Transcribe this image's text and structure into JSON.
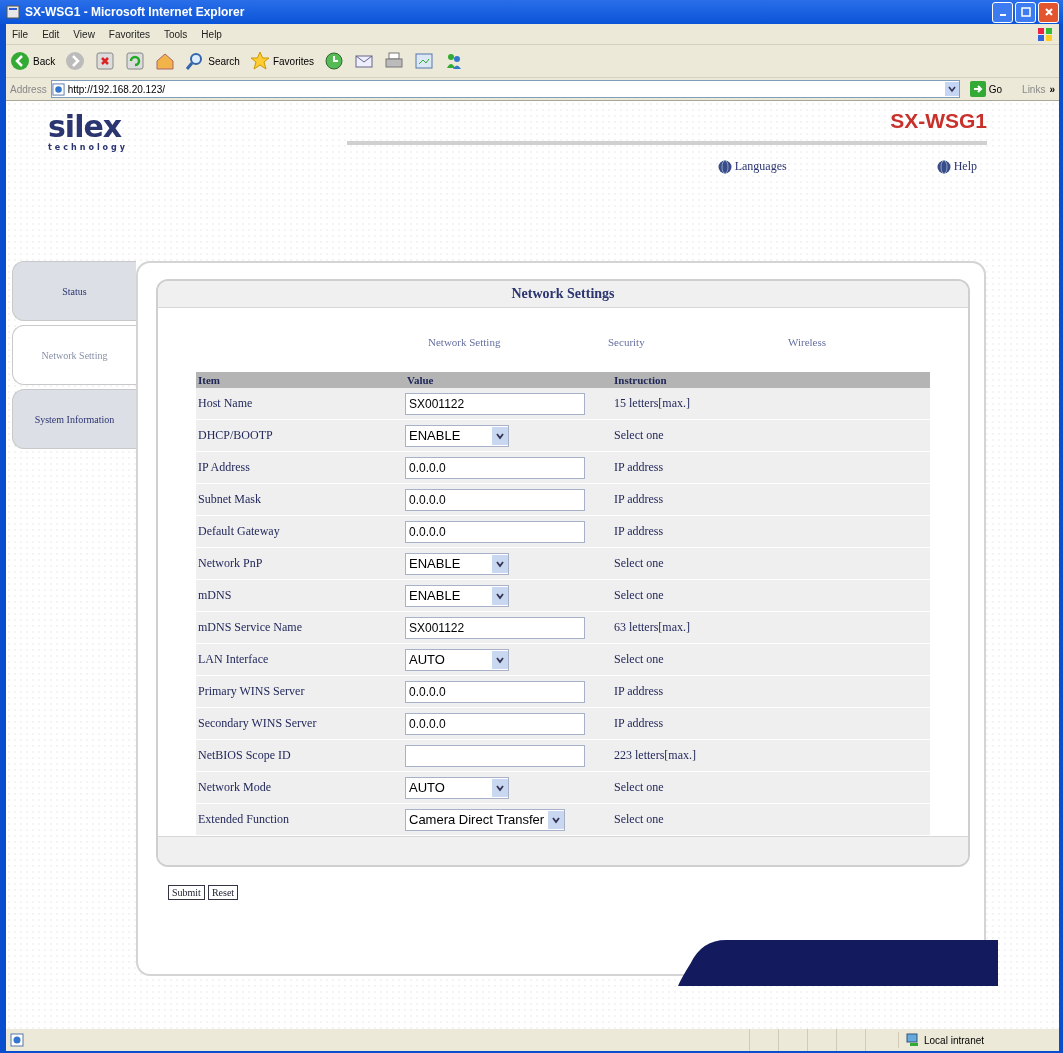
{
  "window": {
    "title": "SX-WSG1 - Microsoft Internet Explorer"
  },
  "menu": [
    "File",
    "Edit",
    "View",
    "Favorites",
    "Tools",
    "Help"
  ],
  "toolbar": {
    "back": "Back",
    "search": "Search",
    "favorites": "Favorites"
  },
  "address_bar": {
    "label": "Address",
    "value": "http://192.168.20.123/",
    "go": "Go",
    "links": "Links",
    "more": "»"
  },
  "page": {
    "logo": "silex",
    "tagline": "technology",
    "model": "SX-WSG1",
    "header_links": [
      "Languages",
      "Help"
    ],
    "side_tabs": [
      {
        "label": "Status",
        "selected": false
      },
      {
        "label": "Network Setting",
        "selected": true
      },
      {
        "label": "System Information",
        "selected": false
      }
    ],
    "panel_title": "Network Settings",
    "sub_tabs": [
      "Network Setting",
      "Security",
      "Wireless"
    ],
    "columns": [
      "Item",
      "Value",
      "Instruction"
    ],
    "rows": [
      {
        "item": "Host Name",
        "kind": "text",
        "value": "SX001122",
        "instruction": "15 letters[max.]"
      },
      {
        "item": "DHCP/BOOTP",
        "kind": "select",
        "value": "ENABLE",
        "instruction": "Select one"
      },
      {
        "item": "IP Address",
        "kind": "text",
        "value": "0.0.0.0",
        "instruction": "IP address"
      },
      {
        "item": "Subnet Mask",
        "kind": "text",
        "value": "0.0.0.0",
        "instruction": "IP address"
      },
      {
        "item": "Default Gateway",
        "kind": "text",
        "value": "0.0.0.0",
        "instruction": "IP address"
      },
      {
        "item": "Network PnP",
        "kind": "select",
        "value": "ENABLE",
        "instruction": "Select one"
      },
      {
        "item": "mDNS",
        "kind": "select",
        "value": "ENABLE",
        "instruction": "Select one"
      },
      {
        "item": "mDNS Service Name",
        "kind": "text",
        "value": "SX001122",
        "instruction": "63 letters[max.]"
      },
      {
        "item": "LAN Interface",
        "kind": "select",
        "value": "AUTO",
        "instruction": "Select one"
      },
      {
        "item": "Primary WINS Server",
        "kind": "text",
        "value": "0.0.0.0",
        "instruction": "IP address"
      },
      {
        "item": "Secondary WINS Server",
        "kind": "text",
        "value": "0.0.0.0",
        "instruction": "IP address"
      },
      {
        "item": "NetBIOS Scope ID",
        "kind": "text",
        "value": "",
        "instruction": "223 letters[max.]"
      },
      {
        "item": "Network Mode",
        "kind": "select",
        "value": "AUTO",
        "instruction": "Select one"
      },
      {
        "item": "Extended Function",
        "kind": "select",
        "value": "Camera Direct Transfer",
        "instruction": "Select one"
      }
    ],
    "buttons": [
      "Submit",
      "Reset"
    ]
  },
  "status_bar": {
    "zone": "Local intranet"
  }
}
